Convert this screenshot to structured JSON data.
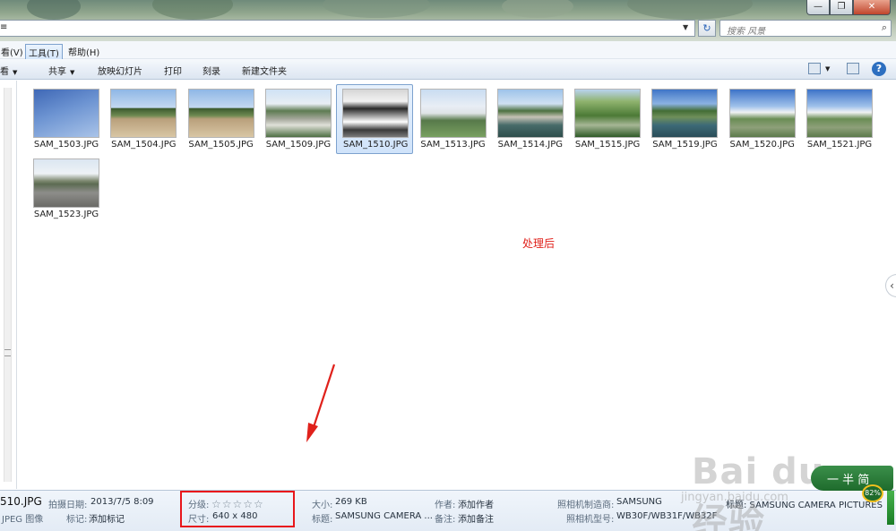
{
  "window": {
    "controls": {
      "minimize": "—",
      "maximize": "❐",
      "close": "✕"
    }
  },
  "address": {
    "prefix": "≡",
    "refresh_glyph": "↻",
    "search_placeholder": "搜索 风景",
    "search_icon": "search-icon"
  },
  "menu": {
    "view": "看(V)",
    "tools": "工具(T)",
    "help": "帮助(H)"
  },
  "toolbar": {
    "view_partial": "看看",
    "share": "共享",
    "slideshow": "放映幻灯片",
    "print": "打印",
    "burn": "刻录",
    "new_folder": "新建文件夹",
    "help_glyph": "?"
  },
  "files": [
    {
      "name": "SAM_1503.JPG",
      "selected": false,
      "scene": "sky"
    },
    {
      "name": "SAM_1504.JPG",
      "selected": false,
      "scene": "plaza"
    },
    {
      "name": "SAM_1505.JPG",
      "selected": false,
      "scene": "plaza"
    },
    {
      "name": "SAM_1509.JPG",
      "selected": false,
      "scene": "rocks"
    },
    {
      "name": "SAM_1510.JPG",
      "selected": true,
      "scene": "rocks-bw"
    },
    {
      "name": "SAM_1513.JPG",
      "selected": false,
      "scene": "building"
    },
    {
      "name": "SAM_1514.JPG",
      "selected": false,
      "scene": "pond"
    },
    {
      "name": "SAM_1515.JPG",
      "selected": false,
      "scene": "willow"
    },
    {
      "name": "SAM_1519.JPG",
      "selected": false,
      "scene": "lake"
    },
    {
      "name": "SAM_1520.JPG",
      "selected": false,
      "scene": "villa"
    },
    {
      "name": "SAM_1521.JPG",
      "selected": false,
      "scene": "villa"
    },
    {
      "name": "SAM_1523.JPG",
      "selected": false,
      "scene": "road"
    }
  ],
  "annotation": {
    "after_text": "处理后",
    "color": "#e0211b"
  },
  "details": {
    "filename": "510.JPG",
    "filetype": "JPEG 图像",
    "date_label": "拍摄日期:",
    "date_value": "2013/7/5 8:09",
    "tags_label": "标记:",
    "tags_value": "添加标记",
    "rating_label": "分级:",
    "rating_stars": "☆☆☆☆☆",
    "rating_value": 0,
    "dims_label": "尺寸:",
    "dims_value": "640 x 480",
    "size_label": "大小:",
    "size_value": "269 KB",
    "title_label": "标题:",
    "title_value": "SAMSUNG CAMERA ...",
    "author_label": "作者:",
    "author_value": "添加作者",
    "comment_label": "备注:",
    "comment_value": "添加备注",
    "maker_label": "照相机制造商:",
    "maker_value": "SAMSUNG",
    "model_label": "照相机型号:",
    "model_value": "WB30F/WB31F/WB32F",
    "subject_partial": "标题: SAMSUNG CAMERA PICTURES"
  },
  "watermark": {
    "logo": "Bai du 经验",
    "sub": "jingyan.baidu.com",
    "badge": "一  半 简",
    "percent": "82%"
  }
}
